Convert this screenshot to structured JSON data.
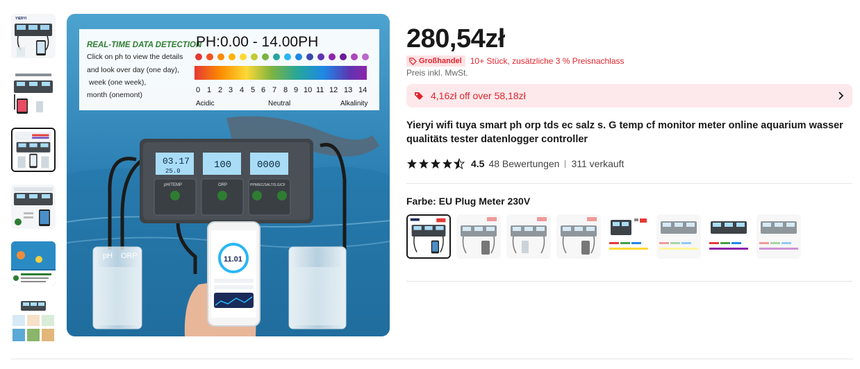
{
  "gallery": {
    "thumbnails": [
      {
        "name": "thumb-1-controller-phone"
      },
      {
        "name": "thumb-2-controller-white"
      },
      {
        "name": "thumb-3-ph-chart",
        "selected": true
      },
      {
        "name": "thumb-4-controller-app"
      },
      {
        "name": "thumb-5-aquarium"
      },
      {
        "name": "thumb-6-collage"
      }
    ],
    "main_image": {
      "banner_heading": "REAL-TIME DATA DETECTION",
      "banner_lines": [
        "Click on ph to view the details",
        "and look over day (one day),",
        "week (one week),",
        "month (onemont)"
      ],
      "ph_title": "PH:0.00 - 14.00PH",
      "scale_numbers": [
        "0",
        "1",
        "2",
        "3",
        "4",
        "5",
        "6",
        "7",
        "8",
        "9",
        "10",
        "11",
        "12",
        "13",
        "14"
      ],
      "scale_labels": {
        "left": "Acidic",
        "mid": "Neutral",
        "right": "Alkalinity"
      },
      "brand": "YIERYI",
      "lcd_values": [
        "03.17",
        "25.0",
        "100",
        "0000"
      ],
      "module_labels": [
        "pH/TEMP",
        "ORP",
        "PPM/EC/SALT/S.G/CF"
      ],
      "phone_reading": "11.01",
      "beaker_labels": [
        "pH",
        "ORP"
      ]
    }
  },
  "product": {
    "price": "280,54zł",
    "wholesale_badge": "Großhandel",
    "wholesale_text": "10+ Stück, zusätzliche 3 % Preisnachlass",
    "vat_note": "Preis inkl. MwSt.",
    "coupon_text": "4,16zł off over 58,18zł",
    "title": "Yieryi wifi tuya smart ph orp tds ec salz s. G temp cf monitor meter online aquarium wasser qualitäts tester datenlogger controller",
    "rating": {
      "value": "4.5",
      "stars": 4.5,
      "reviews": "48 Bewertungen",
      "sold": "311 verkauft"
    },
    "color": {
      "label": "Farbe: EU Plug Meter 230V",
      "options": [
        {
          "name": "variant-1",
          "selected": true
        },
        {
          "name": "variant-2"
        },
        {
          "name": "variant-3"
        },
        {
          "name": "variant-4"
        },
        {
          "name": "variant-5"
        },
        {
          "name": "variant-6"
        },
        {
          "name": "variant-7"
        },
        {
          "name": "variant-8"
        }
      ]
    }
  },
  "colors": {
    "accent_red": "#e1252e",
    "coupon_bg": "#fde9eb",
    "badge_bg": "#fde2e4",
    "text": "#191919"
  }
}
